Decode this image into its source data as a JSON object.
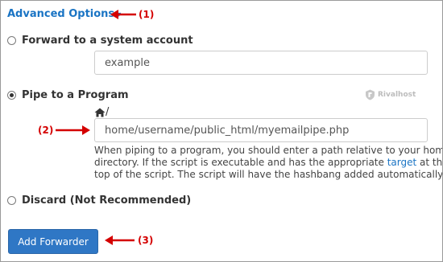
{
  "advanced": {
    "label": "Advanced Options"
  },
  "options": {
    "forward_system": {
      "label": "Forward to a system account",
      "value": "example",
      "selected": false
    },
    "pipe_program": {
      "label": "Pipe to a Program",
      "selected": true,
      "home_suffix": "/",
      "value": "home/username/public_html/myemailpipe.php",
      "help_prefix": "When piping to a program, you should enter a path relative to your home directory. If the script is executable and has the appropriate",
      "help_link": "target",
      "help_suffix": "at the top of the script. The script will have the hashbang added automatically."
    },
    "discard": {
      "label": "Discard (Not Recommended)",
      "selected": false
    }
  },
  "actions": {
    "add_forwarder_label": "Add Forwarder"
  },
  "watermark": {
    "brand": "Rivalhost"
  },
  "annotations": {
    "a1": "(1)",
    "a2": "(2)",
    "a3": "(3)",
    "color": "#d40000"
  },
  "colors": {
    "link": "#1a74c4",
    "primary_button": "#2f77c5"
  },
  "icons": {
    "home": "home-icon",
    "caret": "caret-down-icon"
  }
}
